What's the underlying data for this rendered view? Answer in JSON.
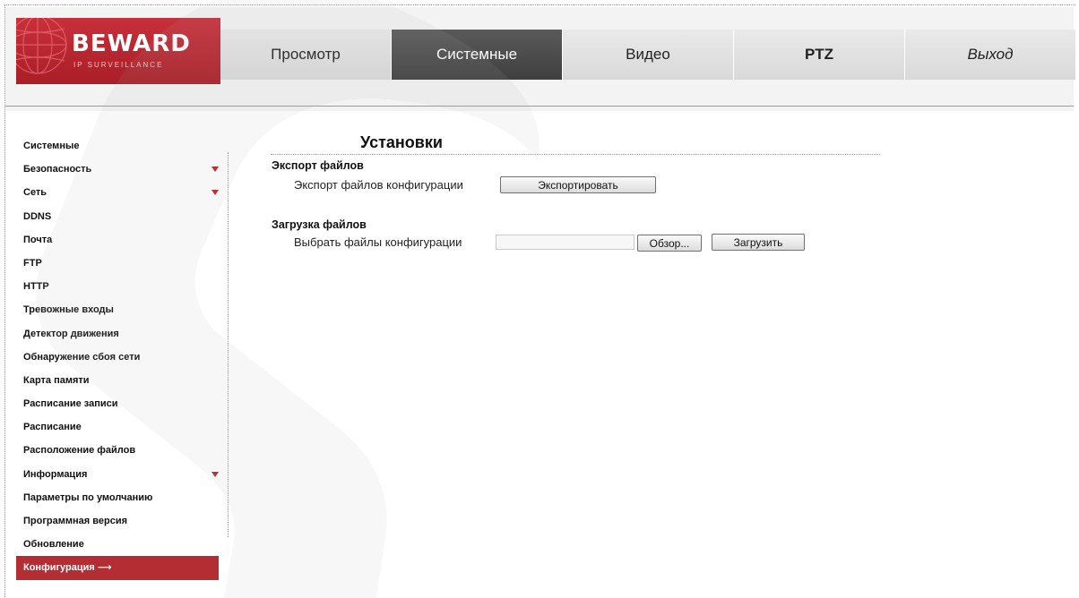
{
  "logo": {
    "name": "BEWARD",
    "subtitle": "IP SURVEILLANCE"
  },
  "nav": {
    "tabs": [
      {
        "label": "Просмотр"
      },
      {
        "label": "Системные",
        "active": true
      },
      {
        "label": "Видео"
      },
      {
        "label": "PTZ"
      },
      {
        "label": "Выход"
      }
    ]
  },
  "sidebar": {
    "items": [
      {
        "label": "Системные"
      },
      {
        "label": "Безопасность",
        "expandable": true
      },
      {
        "label": "Сеть",
        "expandable": true
      },
      {
        "label": "DDNS"
      },
      {
        "label": "Почта"
      },
      {
        "label": "FTP"
      },
      {
        "label": "HTTP"
      },
      {
        "label": "Тревожные входы"
      },
      {
        "label": "Детектор движения"
      },
      {
        "label": "Обнаружение сбоя сети"
      },
      {
        "label": "Карта памяти"
      },
      {
        "label": "Расписание записи"
      },
      {
        "label": "Расписание"
      },
      {
        "label": "Расположение файлов"
      },
      {
        "label": "Информация",
        "expandable": true
      },
      {
        "label": "Параметры по умолчанию"
      },
      {
        "label": "Программная версия"
      },
      {
        "label": "Обновление"
      },
      {
        "label": "Конфигурация",
        "active": true,
        "suffix": "⟶"
      }
    ]
  },
  "main": {
    "title": "Установки",
    "export": {
      "section_title": "Экспорт файлов",
      "label": "Экспорт файлов конфигурации",
      "button": "Экспортировать"
    },
    "upload": {
      "section_title": "Загрузка файлов",
      "label": "Выбрать файлы конфигурации",
      "file_value": "",
      "browse_button": "Обзор...",
      "upload_button": "Загрузить"
    }
  },
  "colors": {
    "brand_red": "#b32d33",
    "active_tab": "#4a4a4a",
    "arrow_red": "#c41e2a"
  }
}
